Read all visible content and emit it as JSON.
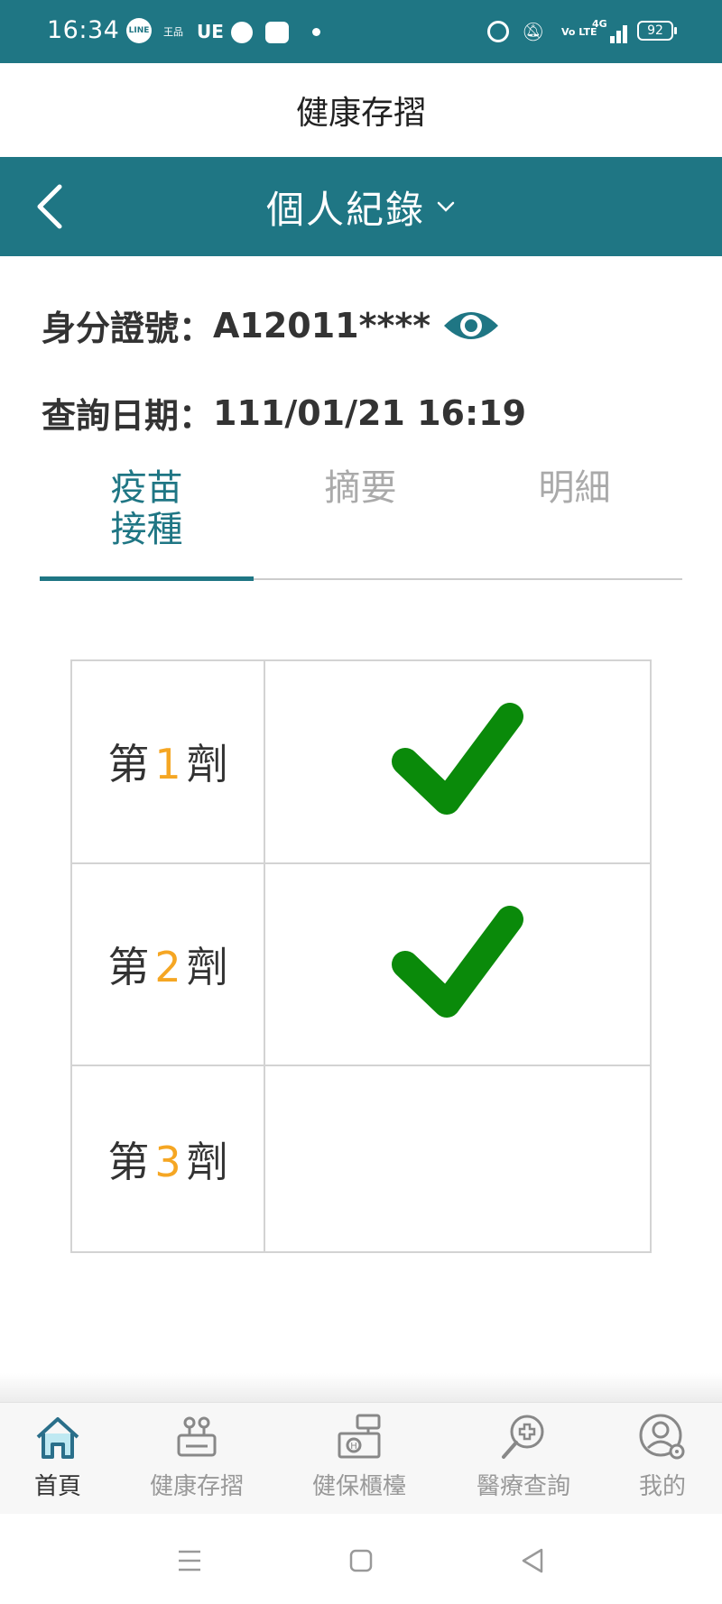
{
  "status_bar": {
    "time": "16:34",
    "carrier_ue": "UE",
    "line_text": "LINE",
    "king_text": "王品",
    "volte_text": "Vo LTE",
    "network": "4G",
    "battery": "92",
    "icons": [
      "line-icon",
      "wangpin-icon",
      "apple-icon",
      "bot-icon",
      "alarm-icon",
      "mute-icon",
      "volte-icon",
      "signal-icon",
      "battery-icon"
    ]
  },
  "app": {
    "title": "健康存摺"
  },
  "header": {
    "title": "個人紀錄",
    "accent": "#1f7684"
  },
  "info": {
    "id_label": "身分證號：",
    "id_value": "A12011****",
    "date_label": "查詢日期：",
    "date_value": "111/01/21 16:19"
  },
  "tabs": [
    {
      "label": "疫苗接種",
      "active": true
    },
    {
      "label": "摘要",
      "active": false
    },
    {
      "label": "明細",
      "active": false
    }
  ],
  "doses": [
    {
      "prefix": "第",
      "number": "1",
      "suffix": "劑",
      "done": true
    },
    {
      "prefix": "第",
      "number": "2",
      "suffix": "劑",
      "done": true
    },
    {
      "prefix": "第",
      "number": "3",
      "suffix": "劑",
      "done": false
    }
  ],
  "colors": {
    "teal": "#1f7684",
    "check_green": "#0a8a0a",
    "dose_number": "#f5a623"
  },
  "bottom_nav": [
    {
      "label": "首頁",
      "icon": "home-icon",
      "active": true
    },
    {
      "label": "健康存摺",
      "icon": "health-passbook-icon",
      "active": false
    },
    {
      "label": "健保櫃檯",
      "icon": "insurance-counter-icon",
      "active": false
    },
    {
      "label": "醫療查詢",
      "icon": "medical-search-icon",
      "active": false
    },
    {
      "label": "我的",
      "icon": "profile-settings-icon",
      "active": false
    }
  ]
}
